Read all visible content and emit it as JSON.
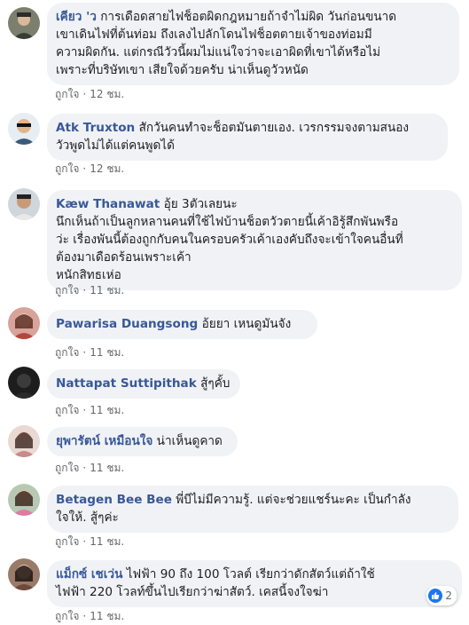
{
  "comments": [
    {
      "author": "เคียว 'ว",
      "lines": [
        "การเดือดสายไฟช็อตผิดกฎหมายถ้าจำไม่ผิด วันก่อนขนาด",
        "เขาเดินไฟที่ต้นท่อม ถึงเลงไปลักโดนไฟช็อตตายเจ้าของท่อมมี",
        "ความผิดกัน. แต่กรณีวัวนี้ผมไม่แน่ใจว่าจะเอาผิดที่เขาได้หรือไม่",
        "เพราะที่บริษัทเขา เสียใจด้วยครับ น่าเห็นดูวัวหนัด"
      ],
      "like": "ถูกใจ",
      "time": "12 ชม."
    },
    {
      "author": "Atk Truxton",
      "lines": [
        "สักวันคนทำจะช็อตมันตายเอง. เวรกรรมจงตามสนอง",
        "วัวพูดไม่ได้แต่คนพูดได้"
      ],
      "like": "ถูกใจ",
      "time": "12 ชม."
    },
    {
      "author": "Kæw Thanawat",
      "lines": [
        "อุ้ย 3ตัวเลยนะ",
        "นึกเห็นถ้าเป็นลูกหลานคนที่ใช้ไฟบ้านช็อตวัวตายนี้เค้าอิรู้สึกพันพรือ",
        "ว่ะ เรื่องพันนี้ต้องถูกกับคนในครอบครัวเค้าเองคับถึงจะเข้าใจคนอื่นที่",
        "ต้องมาเดือดร้อนเพราะเค้า",
        "หนักสิทธเห่อ"
      ],
      "like": "ถูกใจ",
      "time": "11 ชม."
    },
    {
      "author": "Pawarisa Duangsong",
      "lines": [
        "อ้ยยา เหนดูมันจัง"
      ],
      "like": "ถูกใจ",
      "time": "11 ชม."
    },
    {
      "author": "Nattapat Suttipithak",
      "lines": [
        "สู้ๆคั้บ"
      ],
      "like": "ถูกใจ",
      "time": "11 ชม."
    },
    {
      "author": "ยุพารัตน์ เหมือนใจ",
      "lines": [
        "น่าเห็นดูคาด"
      ],
      "like": "ถูกใจ",
      "time": "11 ชม."
    },
    {
      "author": "Betagen Bee Bee",
      "lines": [
        "พี่บีไม่มีความรู้. แต่จะช่วยแชร์นะคะ เป็นกำลัง",
        "ใจให้. สู้ๆค่ะ"
      ],
      "like": "ถูกใจ",
      "time": "11 ชม."
    },
    {
      "author": "แม็กซ์ เชเว่น",
      "lines": [
        "ไฟฟ้า 90 ถึง 100 โวลต์ เรียกว่าดักสัตว์แต่ถ้าใช้",
        "ไฟฟ้า 220 โวลท์ขึ้นไปเรียกว่าฆ่าสัตว์. เคสนี้จงใจฆ่า"
      ],
      "like": "ถูกใจ",
      "time": "11 ชม.",
      "reaction_count": "2"
    }
  ],
  "colors": {
    "author": "#385898",
    "bubble": "#f0f2f5",
    "meta": "#65676b",
    "like_badge": "#1877f2"
  },
  "icons": {
    "reaction": "thumbs-up-icon"
  }
}
